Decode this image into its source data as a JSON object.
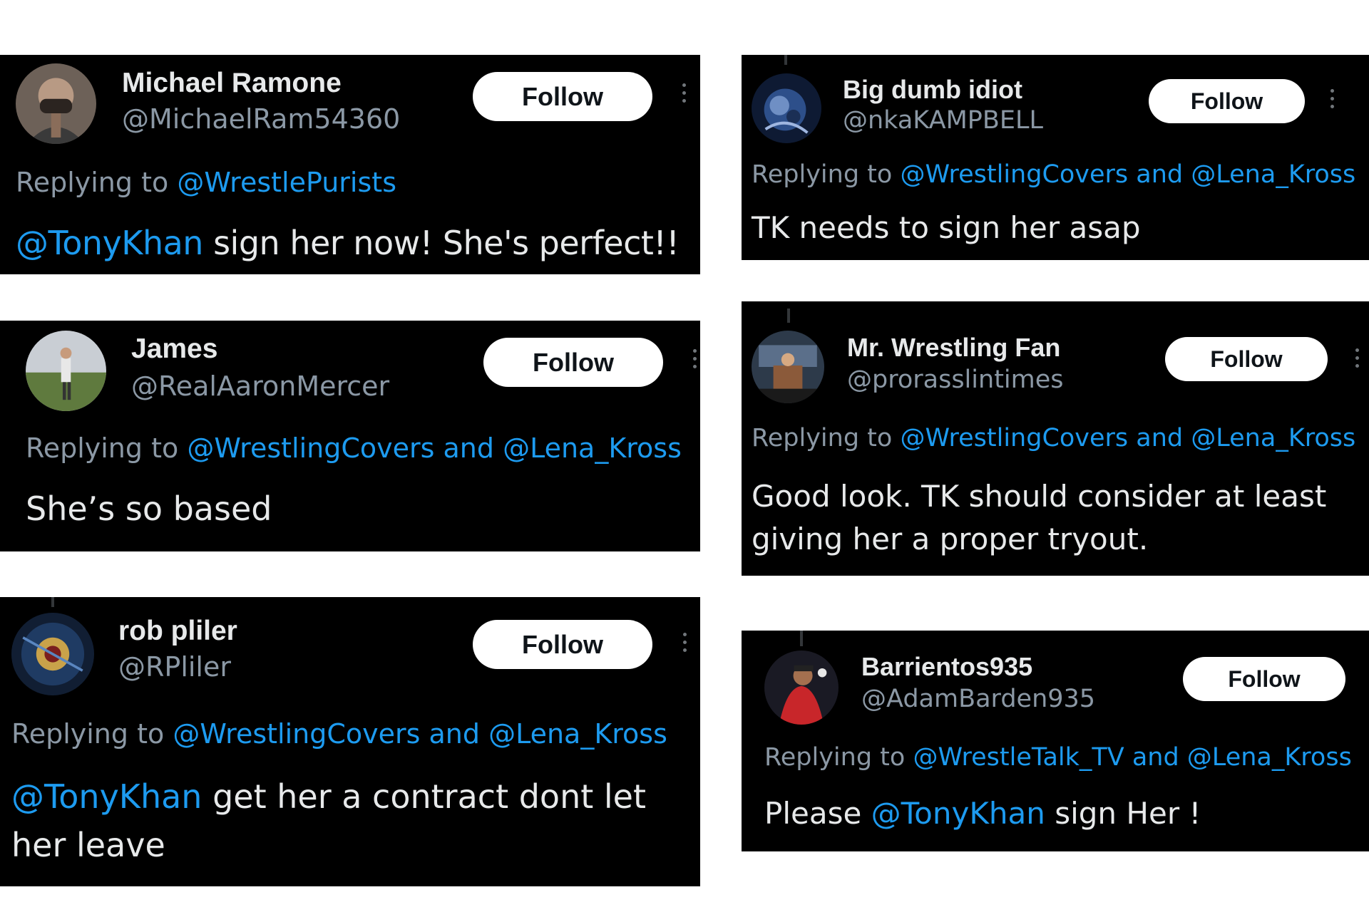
{
  "follow_label": "Follow",
  "reply_prefix": "Replying to ",
  "cards": [
    {
      "name": "Michael Ramone",
      "handle": "@MichaelRam54360",
      "replying_to": "@WrestlePurists",
      "mention": "@TonyKhan",
      "text_after": " sign her now! She's perfect!!"
    },
    {
      "name": "Big dumb idiot",
      "handle": "@nkaKAMPBELL",
      "replying_to": "@WrestlingCovers and @Lena_Kross",
      "text": "TK needs to sign her asap"
    },
    {
      "name": "James",
      "handle": "@RealAaronMercer",
      "replying_to": "@WrestlingCovers and @Lena_Kross",
      "text": "She’s so based"
    },
    {
      "name": "Mr. Wrestling Fan",
      "handle": "@prorasslintimes",
      "replying_to": "@WrestlingCovers and @Lena_Kross",
      "text_line1": "Good look. TK should consider at least",
      "text_line2": "giving her a proper tryout."
    },
    {
      "name": "rob pliler",
      "handle": "@RPliler",
      "replying_to": "@WrestlingCovers and @Lena_Kross",
      "mention": "@TonyKhan",
      "text_after": " get her a contract dont let",
      "text_line2": "her leave"
    },
    {
      "name": "Barrientos935",
      "handle": "@AdamBarden935",
      "replying_to": "@WrestleTalk_TV and @Lena_Kross",
      "text_before": "Please ",
      "mention": "@TonyKhan",
      "text_after": " sign Her !"
    }
  ],
  "colors": {
    "link": "#1d9bf0",
    "card_bg": "#000000",
    "muted": "#8b98a5",
    "text": "#e7e9ea"
  }
}
